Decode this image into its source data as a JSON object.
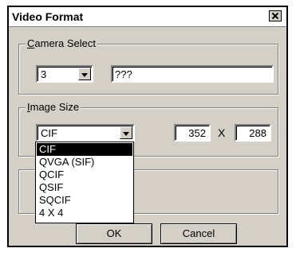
{
  "window": {
    "title": "Video Format"
  },
  "camera_select": {
    "label_prefix": "",
    "label_access": "C",
    "label_rest": "amera Select",
    "camera_value": "3",
    "name_value": "???"
  },
  "image_size": {
    "label_access": "I",
    "label_rest": "mage Size",
    "selected": "CIF",
    "width": "352",
    "times": "X",
    "height": "288",
    "options": [
      "CIF",
      "QVGA (SIF)",
      "QCIF",
      "QSIF",
      "SQCIF",
      "4 X 4"
    ]
  },
  "buttons": {
    "ok": "OK",
    "cancel": "Cancel"
  }
}
